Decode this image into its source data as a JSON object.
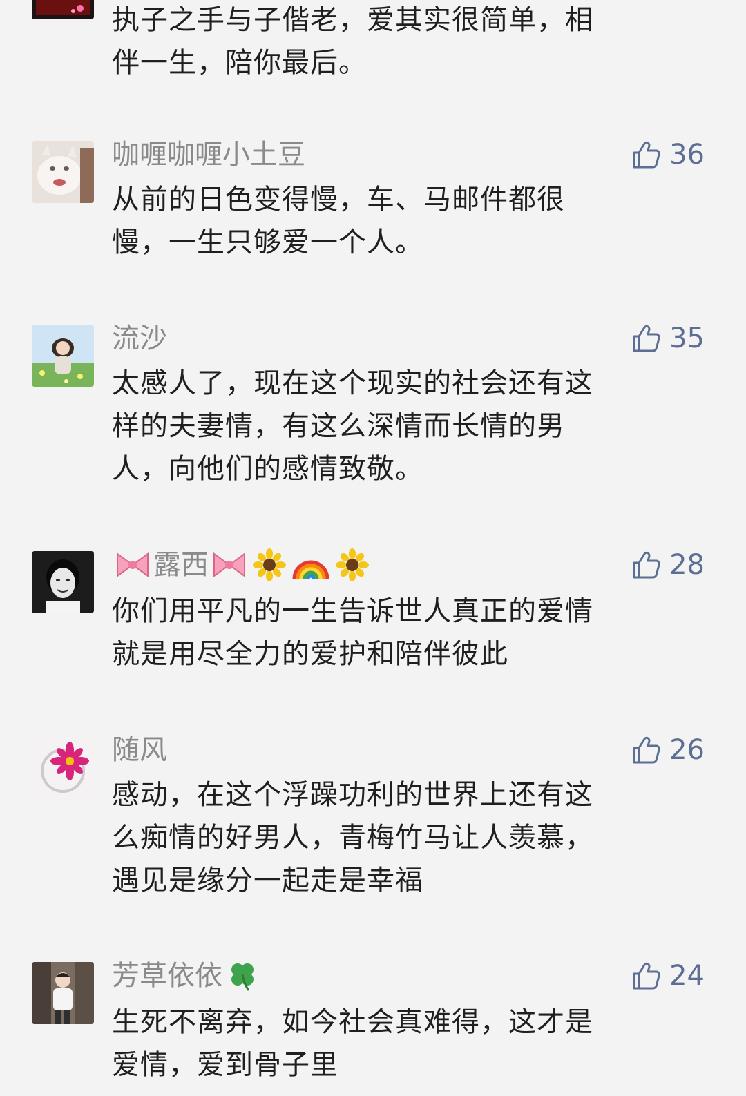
{
  "comments": [
    {
      "name": "",
      "likes": "",
      "lines": [
        "执子之手与子偕老，爱其实很简单，相",
        "伴一生，陪你最后。"
      ]
    },
    {
      "name": "咖喱咖喱小土豆",
      "likes": "36",
      "lines": [
        "从前的日色变得慢，车、马邮件都很",
        "慢，一生只够爱一个人。"
      ]
    },
    {
      "name": "流沙",
      "likes": "35",
      "lines": [
        "太感人了，现在这个现实的社会还有这",
        "样的夫妻情，有这么深情而长情的男",
        "人，向他们的感情致敬。"
      ]
    },
    {
      "name": "露西",
      "likes": "28",
      "lines": [
        "你们用平凡的一生告诉世人真正的爱情",
        "就是用尽全力的爱护和陪伴彼此"
      ]
    },
    {
      "name": "随风",
      "likes": "26",
      "lines": [
        "感动，在这个浮躁功利的世界上还有这",
        "么痴情的好男人，青梅竹马让人羡慕，",
        "遇见是缘分一起走是幸福"
      ]
    },
    {
      "name": "芳草依依",
      "likes": "24",
      "lines": [
        "生死不离弃，如今社会真难得，这才是",
        "爱情，爱到骨子里"
      ]
    }
  ],
  "colors": {
    "background": "#f3f3f3",
    "nickname": "#8a8a8a",
    "like": "#5c6e93",
    "text": "#1f1f1f"
  },
  "icons": {
    "like": "thumbs-up-icon",
    "bow": "ribbon-bow-emoji",
    "sunflower": "sunflower-emoji",
    "rainbow": "rainbow-emoji",
    "clover": "four-leaf-clover-emoji"
  }
}
